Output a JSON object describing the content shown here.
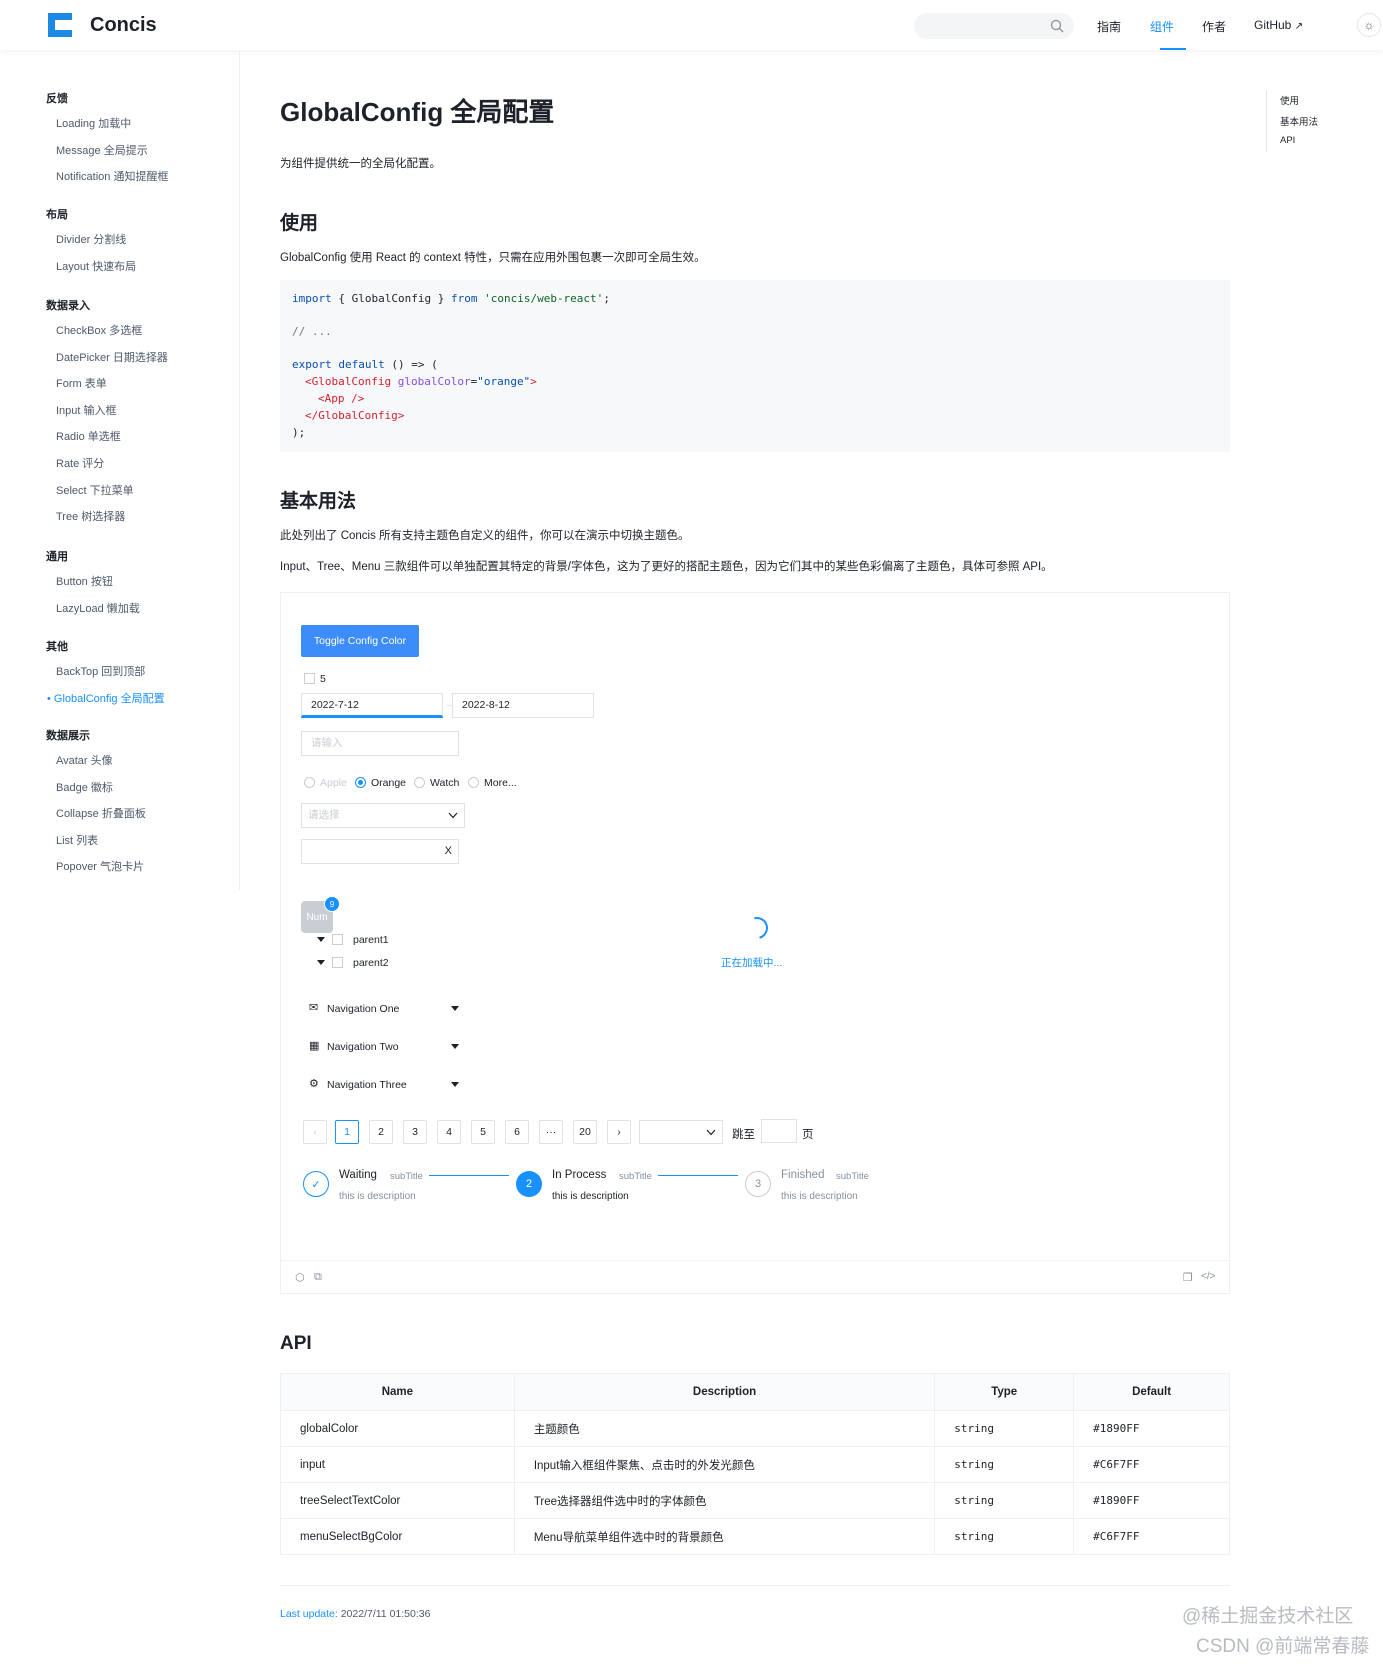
{
  "header": {
    "brand": "Concis",
    "nav": [
      "指南",
      "组件",
      "作者",
      "GitHub"
    ],
    "active_nav": "组件",
    "theme_icon": "sun-icon"
  },
  "sidebar": {
    "groups": [
      {
        "title": "反馈",
        "items": [
          "Loading 加载中",
          "Message 全局提示",
          "Notification 通知提醒框"
        ]
      },
      {
        "title": "布局",
        "items": [
          "Divider 分割线",
          "Layout 快速布局"
        ]
      },
      {
        "title": "数据录入",
        "items": [
          "CheckBox 多选框",
          "DatePicker 日期选择器",
          "Form 表单",
          "Input 输入框",
          "Radio 单选框",
          "Rate 评分",
          "Select 下拉菜单",
          "Tree 树选择器"
        ]
      },
      {
        "title": "通用",
        "items": [
          "Button 按钮",
          "LazyLoad 懒加载"
        ]
      },
      {
        "title": "其他",
        "items": [
          "BackTop 回到顶部",
          "GlobalConfig 全局配置"
        ]
      },
      {
        "title": "数据展示",
        "items": [
          "Avatar 头像",
          "Badge 徽标",
          "Collapse 折叠面板",
          "List 列表",
          "Popover 气泡卡片"
        ]
      }
    ],
    "active_item": "GlobalConfig 全局配置"
  },
  "page": {
    "title": "GlobalConfig 全局配置",
    "intro": "为组件提供统一的全局化配置。",
    "usage_heading": "使用",
    "usage_text": "GlobalConfig 使用 React 的 context 特性，只需在应用外围包裹一次即可全局生效。",
    "basic_heading": "基本用法",
    "basic_text1": "此处列出了 Concis 所有支持主题色自定义的组件，你可以在演示中切换主题色。",
    "basic_text2": "Input、Tree、Menu 三款组件可以单独配置其特定的背景/字体色，这为了更好的搭配主题色，因为它们其中的某些色彩偏离了主题色，具体可参照 API。",
    "api_heading": "API"
  },
  "code": {
    "l1_kw1": "import",
    "l1_mid": " { GlobalConfig } ",
    "l1_kw2": "from",
    "l1_str": " 'concis/web-react'",
    "l1_end": ";",
    "l2": "// ...",
    "l3_kw": "export default",
    "l3_rest": " () => (",
    "l4_tag": "<GlobalConfig",
    "l4_attr": " globalColor",
    "l4_eq": "=",
    "l4_str": "\"orange\"",
    "l4_end": ">",
    "l5": "<App />",
    "l6": "</GlobalConfig>",
    "l7": ");"
  },
  "demo": {
    "toggle_button": "Toggle Config Color",
    "checkbox_label": "5",
    "date_start": "2022-7-12",
    "date_end": "2022-8-12",
    "input_placeholder": "请输入",
    "radios": [
      "Apple",
      "Orange",
      "Watch",
      "More..."
    ],
    "radio_selected": "Orange",
    "select_placeholder": "请选择",
    "clear_icon": "X",
    "avatar_text": "Num",
    "badge_count": "9",
    "loading_text": "正在加载中...",
    "tree": [
      "parent1",
      "parent2"
    ],
    "menu": [
      "Navigation One",
      "Navigation Two",
      "Navigation Three"
    ],
    "pagination": [
      "1",
      "2",
      "3",
      "4",
      "5",
      "6",
      "···",
      "20"
    ],
    "pagination_active": "1",
    "jump_label": "跳至",
    "page_label": "页",
    "steps": [
      {
        "title": "Waiting",
        "sub": "subTitle",
        "desc": "this is description",
        "num": "✓"
      },
      {
        "title": "In Process",
        "sub": "subTitle",
        "desc": "this is description",
        "num": "2"
      },
      {
        "title": "Finished",
        "sub": "subTitle",
        "desc": "this is description",
        "num": "3"
      }
    ]
  },
  "api_table": {
    "headers": [
      "Name",
      "Description",
      "Type",
      "Default"
    ],
    "rows": [
      [
        "globalColor",
        "主题颜色",
        "string",
        "#1890FF"
      ],
      [
        "input",
        "Input输入框组件聚焦、点击时的外发光颜色",
        "string",
        "#C6F7FF"
      ],
      [
        "treeSelectTextColor",
        "Tree选择器组件选中时的字体颜色",
        "string",
        "#1890FF"
      ],
      [
        "menuSelectBgColor",
        "Menu导航菜单组件选中时的背景颜色",
        "string",
        "#C6F7FF"
      ]
    ]
  },
  "toc": [
    "使用",
    "基本用法",
    "API"
  ],
  "footer": {
    "last_label": "Last update:",
    "last_value": "2022/7/11 01:50:36"
  },
  "watermarks": [
    "@稀土掘金技术社区",
    "CSDN @前端常春藤"
  ],
  "colors": {
    "primary": "#1890ff",
    "logo": "#1e88e5"
  }
}
